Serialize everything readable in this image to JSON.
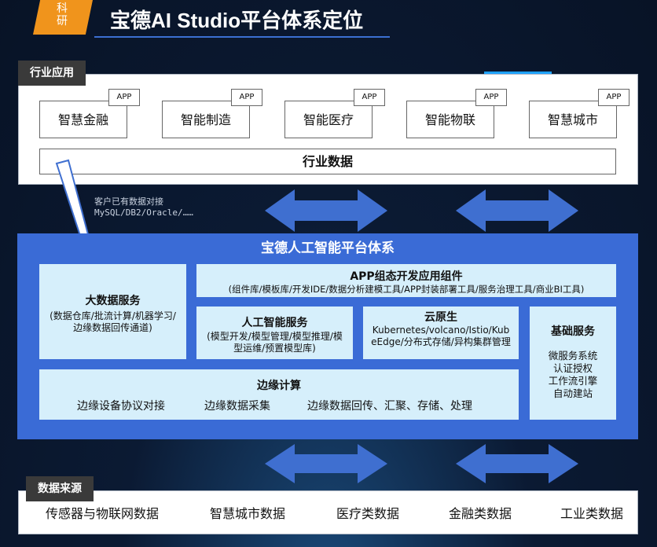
{
  "header": {
    "tag_line1": "科",
    "tag_line2": "研",
    "title": "宝德AI Studio平台体系定位"
  },
  "industry": {
    "label": "行业应用",
    "apps": [
      {
        "name": "智慧金融",
        "tag": "APP"
      },
      {
        "name": "智能制造",
        "tag": "APP"
      },
      {
        "name": "智能医疗",
        "tag": "APP"
      },
      {
        "name": "智能物联",
        "tag": "APP"
      },
      {
        "name": "智慧城市",
        "tag": "APP"
      }
    ],
    "data_bar": "行业数据"
  },
  "note": {
    "line1": "客户已有数据对接",
    "line2": "MySQL/DB2/Oracle/……"
  },
  "platform": {
    "title": "宝德人工智能平台体系",
    "bigdata": {
      "title": "大数据服务",
      "desc": "(数据仓库/批流计算/机器学习/边缘数据回传通道)"
    },
    "app_dev": {
      "title": "APP组态开发应用组件",
      "desc": "(组件库/模板库/开发IDE/数据分析建模工具/APP封装部署工具/服务治理工具/商业BI工具)"
    },
    "ai": {
      "title": "人工智能服务",
      "desc": "(模型开发/模型管理/模型推理/模型运维/预置模型库)"
    },
    "cloud": {
      "title": "云原生",
      "desc": "Kubernetes/volcano/Istio/KubeEdge/分布式存储/异构集群管理"
    },
    "basic": {
      "title": "基础服务",
      "items": [
        "微服务系统",
        "认证授权",
        "工作流引擎",
        "自动建站"
      ]
    },
    "edge": {
      "title": "边缘计算",
      "items": [
        "边缘设备协议对接",
        "边缘数据采集",
        "边缘数据回传、汇聚、存储、处理"
      ]
    }
  },
  "sources": {
    "label": "数据来源",
    "items": [
      "传感器与物联网数据",
      "智慧城市数据",
      "医疗类数据",
      "金融类数据",
      "工业类数据"
    ]
  },
  "colors": {
    "accent_orange": "#f0941c",
    "platform_blue": "#3a6bd6",
    "light_box": "#d6effb",
    "arrow_blue": "#3f6fd0"
  }
}
